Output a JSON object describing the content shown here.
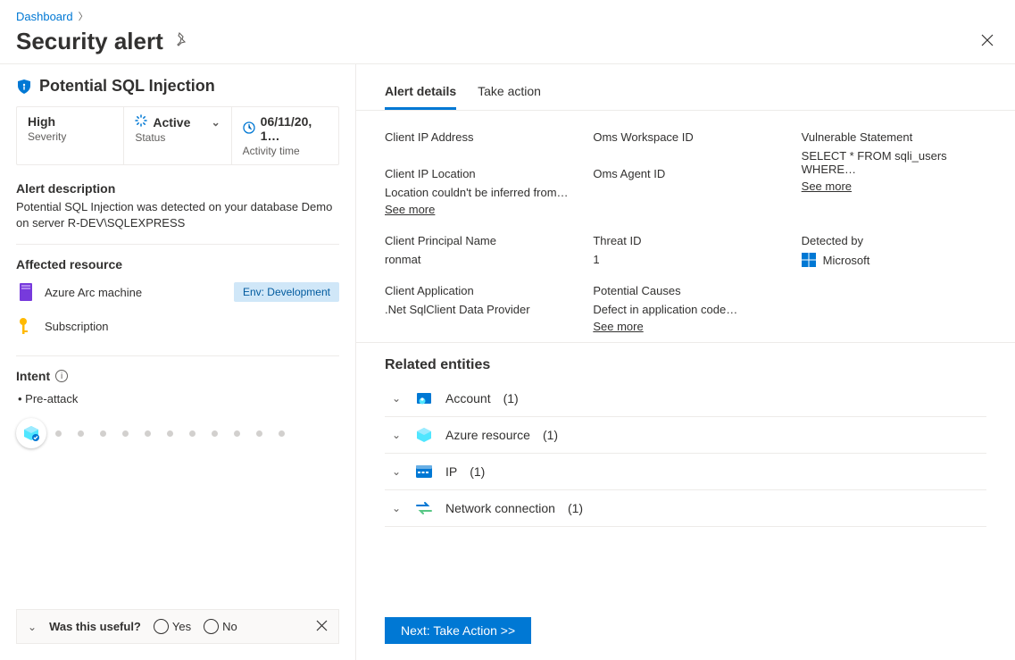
{
  "breadcrumb": {
    "root": "Dashboard"
  },
  "page_title": "Security alert",
  "alert": {
    "title": "Potential SQL Injection",
    "severity_value": "High",
    "severity_label": "Severity",
    "status_value": "Active",
    "status_label": "Status",
    "activity_time_value": "06/11/20, 1…",
    "activity_time_label": "Activity time"
  },
  "description": {
    "heading": "Alert description",
    "text": "Potential SQL Injection was detected on your database Demo on server R-DEV\\SQLEXPRESS"
  },
  "affected": {
    "heading": "Affected resource",
    "resource_name": "Azure Arc machine",
    "env_tag": "Env: Development",
    "subscription_label": "Subscription"
  },
  "intent": {
    "heading": "Intent",
    "item": "Pre-attack"
  },
  "feedback": {
    "question": "Was this useful?",
    "yes": "Yes",
    "no": "No"
  },
  "tabs": {
    "details": "Alert details",
    "take_action": "Take action"
  },
  "fields": {
    "client_ip_address": {
      "label": "Client IP Address",
      "value": ""
    },
    "client_ip_location": {
      "label": "Client IP Location",
      "value": "Location couldn't be inferred from…",
      "see_more": "See more"
    },
    "client_principal_name": {
      "label": "Client Principal Name",
      "value": "ronmat"
    },
    "client_application": {
      "label": "Client Application",
      "value": ".Net SqlClient Data Provider"
    },
    "oms_workspace_id": {
      "label": "Oms Workspace ID",
      "value": ""
    },
    "oms_agent_id": {
      "label": "Oms Agent ID",
      "value": ""
    },
    "threat_id": {
      "label": "Threat ID",
      "value": "1"
    },
    "potential_causes": {
      "label": "Potential Causes",
      "value": "Defect in application code…",
      "see_more": "See more"
    },
    "vulnerable_statement": {
      "label": "Vulnerable Statement",
      "value": "SELECT * FROM sqli_users WHERE…",
      "see_more": "See more"
    },
    "detected_by": {
      "label": "Detected by",
      "value": "Microsoft"
    }
  },
  "related": {
    "heading": "Related entities",
    "items": [
      {
        "name": "Account",
        "count": "(1)"
      },
      {
        "name": "Azure resource",
        "count": "(1)"
      },
      {
        "name": "IP",
        "count": "(1)"
      },
      {
        "name": "Network connection",
        "count": "(1)"
      }
    ]
  },
  "footer": {
    "next_button": "Next: Take Action  >>"
  }
}
